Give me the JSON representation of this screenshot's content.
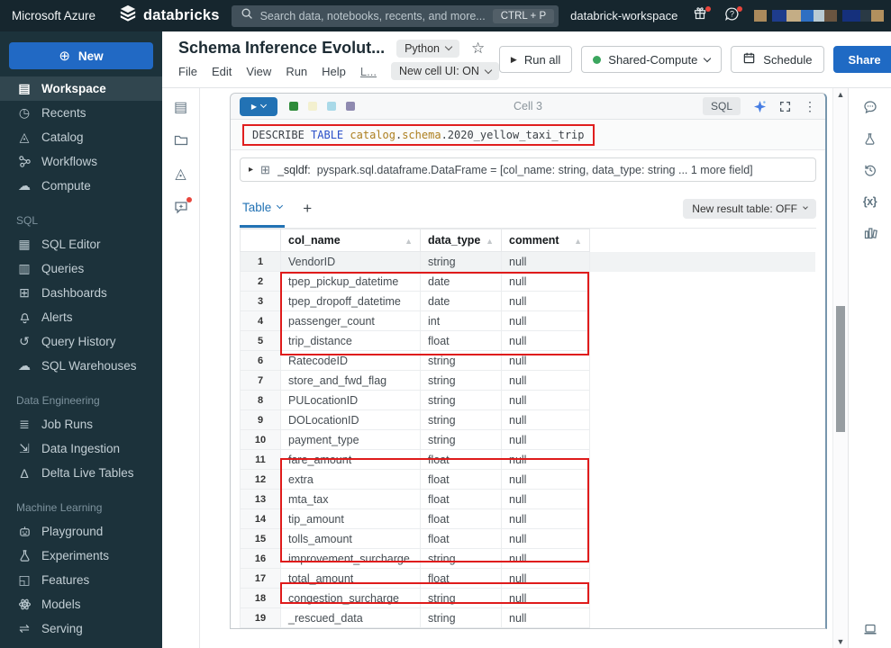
{
  "colors": {
    "accent_blue": "#2272b4",
    "share_blue": "#1f6ac4",
    "annotation_red": "#e01e1e",
    "running_green": "#3ba65e",
    "topbar_bg": "#16262e",
    "sidebar_bg": "#1c323b"
  },
  "topbar": {
    "azure_label": "Microsoft Azure",
    "brand": "databricks",
    "search": {
      "placeholder": "Search data, notebooks, recents, and more...",
      "shortcut": "CTRL + P"
    },
    "workspace_name": "databrick-workspace",
    "user_blocks_small": [
      "#ab8a5c"
    ],
    "user_blocks_a": [
      "#1e3c8c",
      "#c4ad85",
      "#2f6fc2",
      "#b9cbd3",
      "#6a5540"
    ],
    "user_blocks_b": [
      "#15307c",
      "#2a3a45",
      "#b2905e"
    ]
  },
  "sidebar": {
    "new_button": "New",
    "main_items": [
      {
        "label": "Workspace",
        "icon": "workspace",
        "active": true
      },
      {
        "label": "Recents",
        "icon": "recents"
      },
      {
        "label": "Catalog",
        "icon": "catalog"
      },
      {
        "label": "Workflows",
        "icon": "workflows"
      },
      {
        "label": "Compute",
        "icon": "compute"
      }
    ],
    "sections": [
      {
        "title": "SQL",
        "items": [
          {
            "label": "SQL Editor",
            "icon": "sql-editor"
          },
          {
            "label": "Queries",
            "icon": "queries"
          },
          {
            "label": "Dashboards",
            "icon": "dashboards"
          },
          {
            "label": "Alerts",
            "icon": "alerts"
          },
          {
            "label": "Query History",
            "icon": "query-history"
          },
          {
            "label": "SQL Warehouses",
            "icon": "sql-warehouses"
          }
        ]
      },
      {
        "title": "Data Engineering",
        "items": [
          {
            "label": "Job Runs",
            "icon": "job-runs"
          },
          {
            "label": "Data Ingestion",
            "icon": "data-ingestion"
          },
          {
            "label": "Delta Live Tables",
            "icon": "delta-live-tables"
          }
        ]
      },
      {
        "title": "Machine Learning",
        "items": [
          {
            "label": "Playground",
            "icon": "playground"
          },
          {
            "label": "Experiments",
            "icon": "experiments"
          },
          {
            "label": "Features",
            "icon": "features"
          },
          {
            "label": "Models",
            "icon": "models"
          },
          {
            "label": "Serving",
            "icon": "serving"
          }
        ]
      }
    ]
  },
  "notebook": {
    "title": "Schema Inference Evolut...",
    "language": "Python",
    "menu": [
      "File",
      "Edit",
      "View",
      "Run",
      "Help",
      "L..."
    ],
    "cell_ui_label": "New cell UI: ON",
    "actions": {
      "run_all": "Run all",
      "cluster": "Shared-Compute",
      "schedule": "Schedule",
      "share": "Share"
    }
  },
  "left_toolbar_icons": [
    "table-of-contents",
    "folder",
    "catalog",
    "assistant"
  ],
  "cell": {
    "label": "Cell 3",
    "language_badge": "SQL",
    "marker_colors": [
      "#2e8b3a",
      "#f3f0cf",
      "#a9d9e8",
      "#8f8ab0"
    ],
    "code_tokens": [
      {
        "text": "DESCRIBE ",
        "color": "#3c4248"
      },
      {
        "text": "TABLE ",
        "color": "#2a4fc9"
      },
      {
        "text": "catalog",
        "color": "#ad7f1f"
      },
      {
        "text": ".",
        "color": "#3c4248"
      },
      {
        "text": "schema",
        "color": "#ad7f1f"
      },
      {
        "text": ".2020_yellow_taxi_trip",
        "color": "#3c4248"
      }
    ]
  },
  "result": {
    "sqldf_prefix": "_sqldf:",
    "sqldf_text": "pyspark.sql.dataframe.DataFrame = [col_name: string, data_type: string ... 1 more field]",
    "tab_label": "Table",
    "new_table_toggle": "New result table: OFF"
  },
  "result_table": {
    "headers": [
      "col_name",
      "data_type",
      "comment"
    ],
    "rows": [
      [
        "VendorID",
        "string",
        "null"
      ],
      [
        "tpep_pickup_datetime",
        "date",
        "null"
      ],
      [
        "tpep_dropoff_datetime",
        "date",
        "null"
      ],
      [
        "passenger_count",
        "int",
        "null"
      ],
      [
        "trip_distance",
        "float",
        "null"
      ],
      [
        "RatecodeID",
        "string",
        "null"
      ],
      [
        "store_and_fwd_flag",
        "string",
        "null"
      ],
      [
        "PULocationID",
        "string",
        "null"
      ],
      [
        "DOLocationID",
        "string",
        "null"
      ],
      [
        "payment_type",
        "string",
        "null"
      ],
      [
        "fare_amount",
        "float",
        "null"
      ],
      [
        "extra",
        "float",
        "null"
      ],
      [
        "mta_tax",
        "float",
        "null"
      ],
      [
        "tip_amount",
        "float",
        "null"
      ],
      [
        "tolls_amount",
        "float",
        "null"
      ],
      [
        "improvement_surcharge",
        "string",
        "null"
      ],
      [
        "total_amount",
        "float",
        "null"
      ],
      [
        "congestion_surcharge",
        "string",
        "null"
      ],
      [
        "_rescued_data",
        "string",
        "null"
      ]
    ],
    "highlighted_row_ranges": [
      {
        "start": 2,
        "end": 5
      },
      {
        "start": 11,
        "end": 15
      },
      {
        "start": 17,
        "end": 17
      }
    ]
  },
  "right_panel_icons": [
    "comments",
    "experiments",
    "version-history",
    "variables",
    "data-profile"
  ],
  "right_panel_bottom_icon": "terminal"
}
